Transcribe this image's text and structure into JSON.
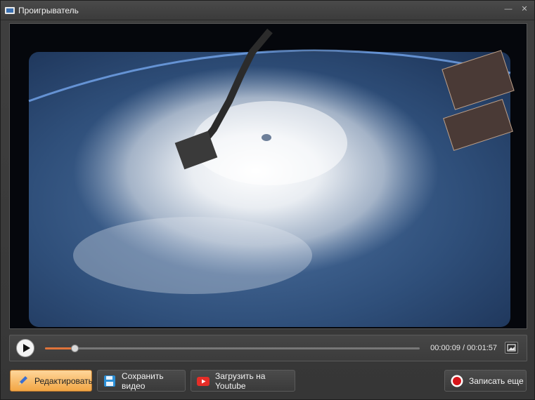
{
  "window": {
    "title": "Проигрыватель",
    "minimize_icon": "minimize-icon",
    "close_icon": "close-icon"
  },
  "video": {
    "thumbnail_description_icon": "video-frame"
  },
  "controls": {
    "play_icon": "play-icon",
    "progress": 0.0796,
    "current_time": "00:00:09",
    "total_time": "00:01:57",
    "time_separator": "/",
    "snapshot_icon": "snapshot-icon"
  },
  "buttons": {
    "edit_label": "Редактировать",
    "save_label": "Сохранить видео",
    "youtube_label": "Загрузить на Youtube",
    "record_label": "Записать еще"
  },
  "colors": {
    "accent": "#f2a644",
    "progress": "#e0733a",
    "youtube": "#e52d27",
    "record": "#d6151a"
  }
}
